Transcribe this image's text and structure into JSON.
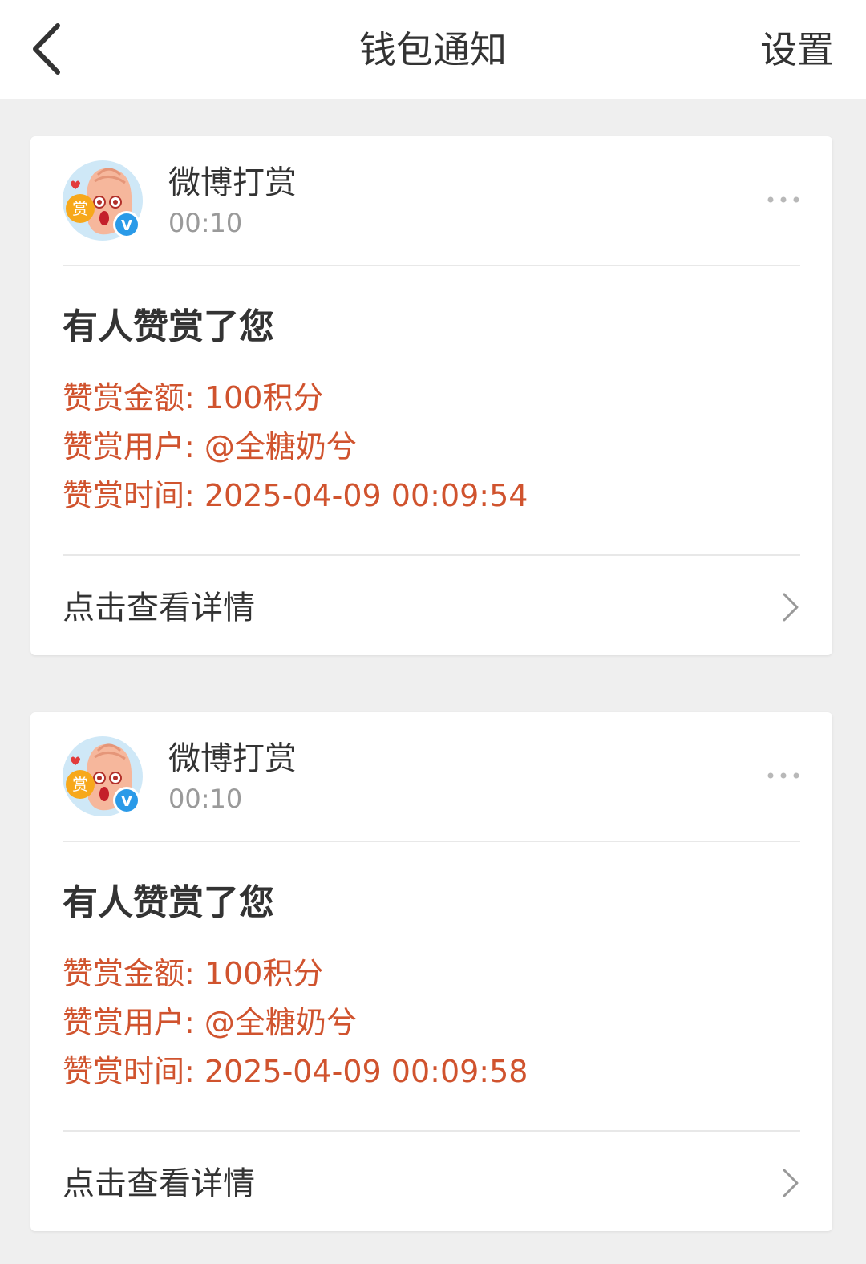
{
  "header": {
    "title": "钱包通知",
    "settings_label": "设置",
    "back_icon": "chevron-left-icon"
  },
  "colors": {
    "accent_text": "#d0532e",
    "verified_badge": "#2a9ae8",
    "page_background": "#efefef"
  },
  "notifications": [
    {
      "sender": "微博打赏",
      "time": "00:10",
      "avatar_icon": "reward-avatar-icon",
      "avatar_badge_text": "赏",
      "verified_mark": "V",
      "title": "有人赞赏了您",
      "lines": [
        "赞赏金额: 100积分",
        "赞赏用户: @全糖奶兮",
        "赞赏时间: 2025-04-09 00:09:54"
      ],
      "details_label": "点击查看详情"
    },
    {
      "sender": "微博打赏",
      "time": "00:10",
      "avatar_icon": "reward-avatar-icon",
      "avatar_badge_text": "赏",
      "verified_mark": "V",
      "title": "有人赞赏了您",
      "lines": [
        "赞赏金额: 100积分",
        "赞赏用户: @全糖奶兮",
        "赞赏时间: 2025-04-09 00:09:58"
      ],
      "details_label": "点击查看详情"
    }
  ]
}
